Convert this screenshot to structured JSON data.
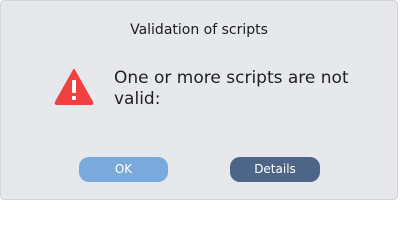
{
  "dialog": {
    "title": "Validation of scripts",
    "icon": "warning-icon",
    "message": "One or more scripts are not valid:",
    "ok_label": "OK",
    "details_label": "Details"
  },
  "colors": {
    "background": "#e6e8ec",
    "warning": "#f04040",
    "ok_button": "#7aa9db",
    "details_button": "#4d6587"
  }
}
